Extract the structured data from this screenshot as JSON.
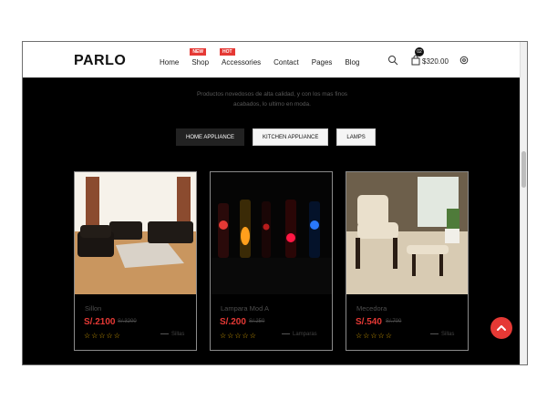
{
  "header": {
    "logo": "PARLO",
    "nav": [
      {
        "label": "Home",
        "badge": ""
      },
      {
        "label": "Shop",
        "badge": "NEW"
      },
      {
        "label": "Accessories",
        "badge": "HOT"
      },
      {
        "label": "Contact",
        "badge": ""
      },
      {
        "label": "Pages",
        "badge": ""
      },
      {
        "label": "Blog",
        "badge": ""
      }
    ],
    "cart_count": "02",
    "cart_total": "$320.00"
  },
  "intro": {
    "line1": "Productos novedosos de alta calidad, y con los mas finos",
    "line2": "acabados, lo ultimo en moda."
  },
  "tabs": [
    "HOME APPLIANCE",
    "KITCHEN APPLIANCE",
    "LAMPS"
  ],
  "products": [
    {
      "name": "Sillon",
      "price": "S/.2100",
      "old_price": "S/.3200",
      "category": "Sillas",
      "rating": "☆☆☆☆☆"
    },
    {
      "name": "Lampara Mod A",
      "price": "S/.200",
      "old_price": "S/.250",
      "category": "Lamparas",
      "rating": "☆☆☆☆☆"
    },
    {
      "name": "Mecedora",
      "price": "S/.540",
      "old_price": "S/.700",
      "category": "Sillas",
      "rating": "☆☆☆☆☆"
    }
  ],
  "icons": [
    "search-icon",
    "cart-icon",
    "gear-icon",
    "arrow-up-icon"
  ],
  "colors": {
    "accent": "#e53935",
    "background": "#000000",
    "header": "#ffffff"
  }
}
